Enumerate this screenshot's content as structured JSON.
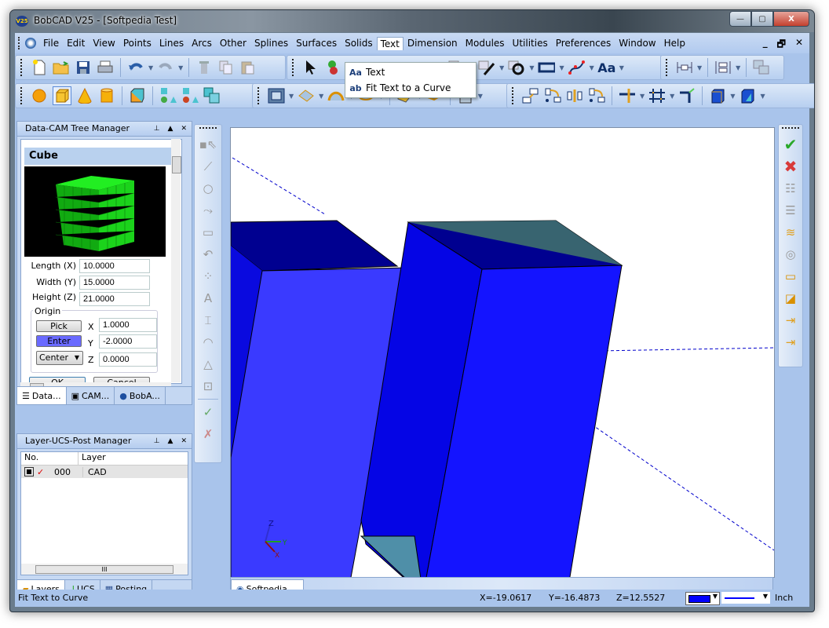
{
  "window": {
    "title": "BobCAD V25 - [Softpedia Test]",
    "app_icon_label": "V25",
    "minimize": "—",
    "maximize": "▢",
    "close": "X"
  },
  "menubar": {
    "items": [
      "File",
      "Edit",
      "View",
      "Points",
      "Lines",
      "Arcs",
      "Other",
      "Splines",
      "Surfaces",
      "Solids",
      "Text",
      "Dimension",
      "Modules",
      "Utilities",
      "Preferences",
      "Window",
      "Help"
    ],
    "active": "Text",
    "mdi_minimize": "_",
    "mdi_restore": "🗗",
    "mdi_close": "✕"
  },
  "text_menu": {
    "items": [
      {
        "icon": "Aa",
        "label": "Text"
      },
      {
        "icon": "ab",
        "label": "Fit Text to a Curve"
      }
    ]
  },
  "data_cam_panel": {
    "title": "Data-CAM Tree Manager",
    "section_title": "Cube",
    "fields": [
      {
        "label": "Length (X)",
        "value": "10.0000"
      },
      {
        "label": "Width (Y)",
        "value": "15.0000"
      },
      {
        "label": "Height (Z)",
        "value": "21.0000"
      }
    ],
    "origin": {
      "group_label": "Origin",
      "pick_label": "Pick",
      "enter_label": "Enter",
      "anchor_value": "Center",
      "x_label": "X",
      "x_value": "1.0000",
      "y_label": "Y",
      "y_value": "-2.0000",
      "z_label": "Z",
      "z_value": "0.0000"
    },
    "ok_label": "OK",
    "cancel_label": "Cancel",
    "tabs": [
      "Data...",
      "CAM...",
      "BobA..."
    ]
  },
  "layer_panel": {
    "title": "Layer-UCS-Post Manager",
    "columns": [
      "No.",
      "Layer"
    ],
    "rows": [
      {
        "no": "000",
        "layer": "CAD",
        "visible": true
      }
    ],
    "scroll_label": "III",
    "tabs": [
      "Layers",
      "UCS",
      "Posting"
    ]
  },
  "viewport": {
    "doc_tab": "Softpedia ...",
    "axis_labels": {
      "x": "X",
      "y": "Y",
      "z": "Z"
    },
    "colors": {
      "front": "#2a2aff",
      "side": "#0a0adf",
      "top": "#000090",
      "teal": "#3a6470",
      "teal_light": "#4f8fa8"
    }
  },
  "statusbar": {
    "message": "Fit Text to Curve",
    "x": "X=-19.0617",
    "y": "Y=-16.4873",
    "z": "Z=12.5527",
    "color_swatch": "#0000ff",
    "units": "Inch"
  }
}
